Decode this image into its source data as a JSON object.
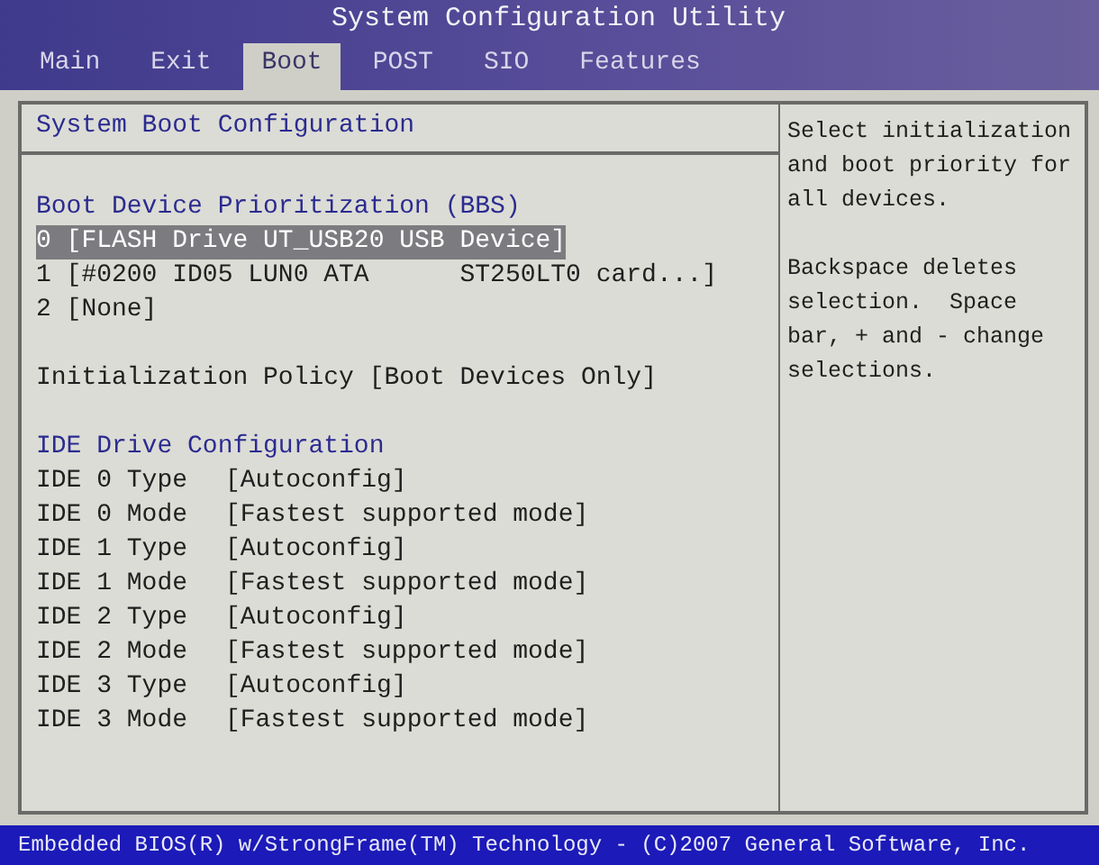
{
  "window": {
    "title": "System Configuration Utility"
  },
  "tabs": [
    {
      "label": "Main",
      "selected": false
    },
    {
      "label": "Exit",
      "selected": false
    },
    {
      "label": "Boot",
      "selected": true
    },
    {
      "label": "POST",
      "selected": false
    },
    {
      "label": "SIO",
      "selected": false
    },
    {
      "label": "Features",
      "selected": false
    }
  ],
  "panel_title": "System Boot Configuration",
  "boot_section": {
    "heading": "Boot Device Prioritization (BBS)",
    "devices": [
      {
        "text": "0 [FLASH Drive UT_USB20 USB Device]",
        "selected": true
      },
      {
        "text": "1 [#0200 ID05 LUN0 ATA      ST250LT0 card...]",
        "selected": false
      },
      {
        "text": "2 [None]",
        "selected": false
      }
    ]
  },
  "init_policy": {
    "label": "Initialization Policy",
    "value": "[Boot Devices Only]"
  },
  "ide_section": {
    "heading": "IDE Drive Configuration",
    "settings": [
      {
        "label": "IDE 0 Type",
        "value": "[Autoconfig]"
      },
      {
        "label": "IDE 0 Mode",
        "value": "[Fastest supported mode]"
      },
      {
        "label": "IDE 1 Type",
        "value": "[Autoconfig]"
      },
      {
        "label": "IDE 1 Mode",
        "value": "[Fastest supported mode]"
      },
      {
        "label": "IDE 2 Type",
        "value": "[Autoconfig]"
      },
      {
        "label": "IDE 2 Mode",
        "value": "[Fastest supported mode]"
      },
      {
        "label": "IDE 3 Type",
        "value": "[Autoconfig]"
      },
      {
        "label": "IDE 3 Mode",
        "value": "[Fastest supported mode]"
      }
    ]
  },
  "help": [
    "Select initialization and boot priority for all devices.",
    "Backspace deletes selection.  Space bar, + and - change selections."
  ],
  "status_bar": "Embedded BIOS(R) w/StrongFrame(TM) Technology - (C)2007 General Software, Inc."
}
